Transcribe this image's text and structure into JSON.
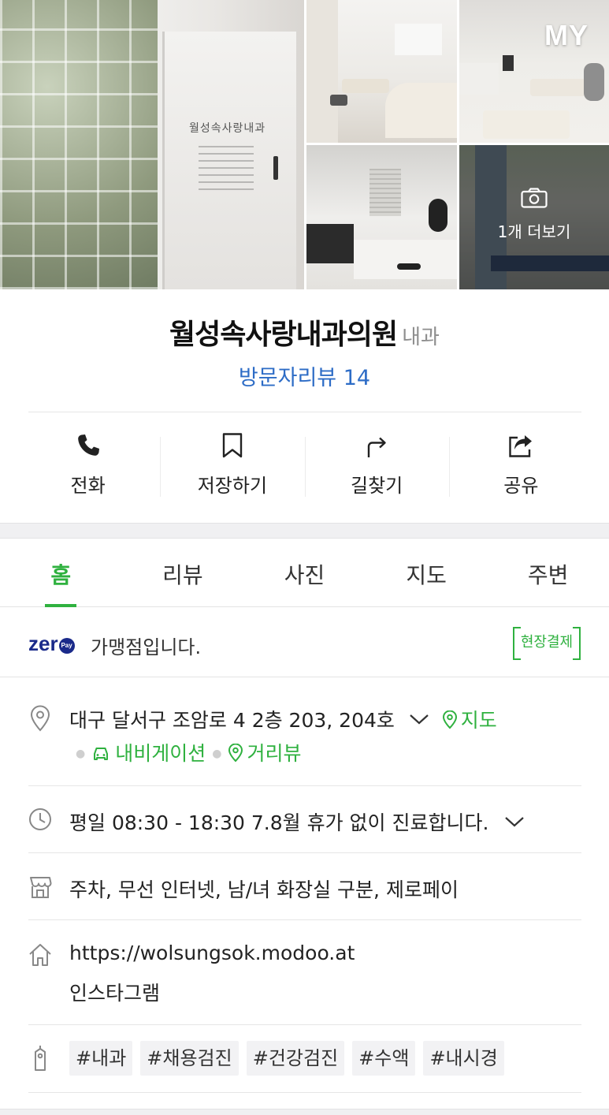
{
  "gallery": {
    "my_label": "MY",
    "more_photos_label": "1개 더보기",
    "main_sign_text": "월성속사랑내과"
  },
  "place": {
    "name": "월성속사랑내과의원",
    "category": "내과",
    "reviews_label": "방문자리뷰 14"
  },
  "actions": [
    {
      "label": "전화",
      "icon": "phone-icon"
    },
    {
      "label": "저장하기",
      "icon": "bookmark-icon"
    },
    {
      "label": "길찾기",
      "icon": "directions-icon"
    },
    {
      "label": "공유",
      "icon": "share-icon"
    }
  ],
  "tabs": [
    {
      "label": "홈",
      "active": true
    },
    {
      "label": "리뷰",
      "active": false
    },
    {
      "label": "사진",
      "active": false
    },
    {
      "label": "지도",
      "active": false
    },
    {
      "label": "주변",
      "active": false
    }
  ],
  "zeropay": {
    "logo_text": "zer",
    "logo_pay": "Pay",
    "text": "가맹점입니다.",
    "badge": "현장결제"
  },
  "address": {
    "text": "대구 달서구 조암로 4 2층 203, 204호",
    "map_link": "지도",
    "navigation_link": "내비게이션",
    "streetview_link": "거리뷰"
  },
  "hours": {
    "text": "평일 08:30 - 18:30 7.8월 휴가 없이 진료합니다."
  },
  "facilities": {
    "text": "주차, 무선 인터넷, 남/녀 화장실 구분, 제로페이"
  },
  "homepage": {
    "url": "https://wolsungsok.modoo.at",
    "instagram": "인스타그램"
  },
  "tags": [
    "#내과",
    "#채용검진",
    "#건강검진",
    "#수액",
    "#내시경"
  ],
  "colors": {
    "accent_green": "#2fb13f",
    "link_blue": "#2d6cc6",
    "zeropay_navy": "#1a2a8a"
  }
}
